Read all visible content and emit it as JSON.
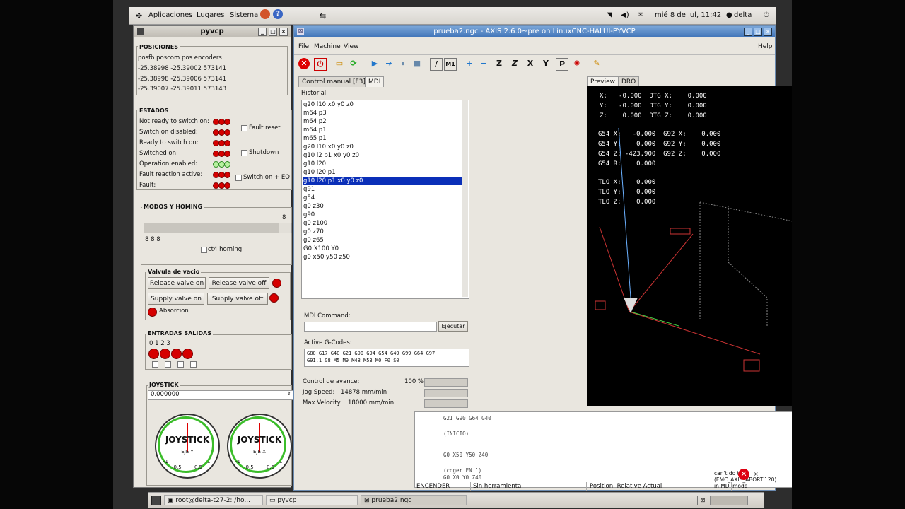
{
  "panel": {
    "apps": "Aplicaciones",
    "places": "Lugares",
    "system": "Sistema",
    "datetime": "mié 8 de jul, 11:42",
    "user": "delta"
  },
  "pyvcp": {
    "title": "pyvcp",
    "posiciones": {
      "title": "POSICIONES",
      "header": "posfb poscom pos encoders",
      "rows": [
        "-25.38998 -25.39002 573141",
        "-25.38998 -25.39006 573141",
        "-25.39007 -25.39011 573143"
      ]
    },
    "estados": {
      "title": "ESTADOS",
      "labels": [
        "Not ready to switch on:",
        "Switch on disabled:",
        "Ready to switch on:",
        "Switched on:",
        "Operation enabled:",
        "Fault reaction active:",
        "Fault:"
      ],
      "fault_reset": "Fault reset",
      "shutdown": "Shutdown",
      "switch_on_eo": "Switch on + EO"
    },
    "modos": {
      "title": "MODOS Y HOMING",
      "value": "8",
      "digits": "8 8 8",
      "homing_label": "ct4 homing"
    },
    "valvula": {
      "title": "Valvula de vacio",
      "release_on": "Release valve on",
      "release_off": "Release valve off",
      "supply_on": "Supply valve on",
      "supply_off": "Supply valve off",
      "absorcion": "Absorcion"
    },
    "entradas": {
      "title": "ENTRADAS SALIDAS",
      "indices": "0 1 2 3"
    },
    "joystick": {
      "title": "JOYSTICK",
      "value": "0.000000",
      "gauge1_label": "JOYSTICK",
      "gauge1_axis": "EJE Y",
      "gauge2_label": "JOYSTICK",
      "gauge2_axis": "EJE X",
      "scale_neg": "-1",
      "scale_pos": "1",
      "scale_mid_neg": "-0.5",
      "scale_mid_pos": "0.5"
    }
  },
  "axis": {
    "title": "prueba2.ngc - AXIS 2.6.0~pre on LinuxCNC-HALUI-PYVCP",
    "menu": [
      "File",
      "Machine",
      "View"
    ],
    "help": "Help",
    "tabs": [
      "Control manual [F3]",
      "MDI"
    ],
    "right_tabs": [
      "Preview",
      "DRO"
    ],
    "historial_label": "Historial:",
    "history": [
      "g20 l10 x0 y0 z0",
      "m64 p3",
      "m64 p2",
      "m64 p1",
      "m65 p1",
      "g20 l10 x0 y0 z0",
      "g10 l2 p1 x0 y0 z0",
      "g10 l20",
      "g10 l20 p1",
      "g10 l20 p1 x0 y0 z0",
      "g91",
      "g54",
      "g0 z30",
      "g90",
      "g0 z100",
      "g0 z70",
      "g0 z65",
      "G0 X100 Y0",
      "g0 x50 y50 z50"
    ],
    "selected_index": 9,
    "mdi_command_label": "MDI Command:",
    "ejecutar": "Ejecutar",
    "active_gcodes_label": "Active G-Codes:",
    "active_gcodes": [
      "G80 G17 G40 G21 G90 G94 G54 G49 G99 G64 G97",
      "G91.1 G8 M5 M9 M48 M53 M0 F0 S0"
    ],
    "feed_label": "Control de avance:",
    "feed_value": "100 %",
    "jog_label": "Jog Speed:",
    "jog_value": "14878 mm/min",
    "maxvel_label": "Max Velocity:",
    "maxvel_value": "18000 mm/min",
    "dro": {
      "rows1": [
        "X:   -0.000  DTG X:    0.000",
        "Y:   -0.000  DTG Y:    0.000",
        "Z:    0.000  DTG Z:    0.000"
      ],
      "rows2": [
        "G54 X:   -0.000  G92 X:    0.000",
        "G54 Y:    0.000  G92 Y:    0.000",
        "G54 Z: -423.900  G92 Z:    0.000",
        "G54 R:    0.000"
      ],
      "rows3": [
        "TLO X:    0.000",
        "TLO Y:    0.000",
        "TLO Z:    0.000"
      ]
    },
    "gcode_lines": [
      "G21 G90 G64 G40",
      "",
      "(INICIO)",
      "",
      "",
      "G0 X50 Y50 Z40",
      "",
      "(coger EN 1)",
      "G0 X0 Y0 Z40"
    ],
    "status": {
      "state": "ENCENDER",
      "tool": "Sin herramienta",
      "position": "Position: Relative Actual"
    },
    "error": "can't do that (EMC_AXIS_ABORT:120) in MDI mode"
  },
  "taskbar": {
    "items": [
      "root@delta-t27-2: /ho...",
      "pyvcp",
      "prueba2.ngc"
    ]
  },
  "colors": {
    "led_on": "#d50000",
    "led_green": "#b8f0a0",
    "selection": "#0a2fb8",
    "title_blue": "#3f73b8"
  }
}
